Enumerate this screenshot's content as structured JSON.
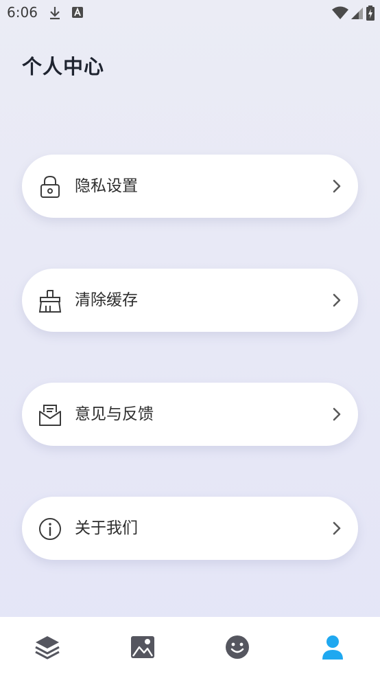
{
  "status_bar": {
    "time": "6:06",
    "icons": [
      "download-icon",
      "text-a-icon",
      "wifi-icon",
      "signal-icon",
      "battery-charging-icon"
    ]
  },
  "page": {
    "title": "个人中心"
  },
  "menu": [
    {
      "label": "隐私设置",
      "icon": "lock-icon"
    },
    {
      "label": "清除缓存",
      "icon": "broom-icon"
    },
    {
      "label": "意见与反馈",
      "icon": "mail-feedback-icon"
    },
    {
      "label": "关于我们",
      "icon": "info-icon"
    }
  ],
  "bottom_nav": {
    "items": [
      {
        "icon": "layers-icon",
        "active": false
      },
      {
        "icon": "gallery-icon",
        "active": false
      },
      {
        "icon": "smiley-icon",
        "active": false
      },
      {
        "icon": "person-icon",
        "active": true
      }
    ],
    "active_color": "#1fa8f0",
    "inactive_color": "#55565f"
  },
  "colors": {
    "background": "#e8e9f6",
    "card": "#ffffff",
    "title": "#1f2430"
  }
}
